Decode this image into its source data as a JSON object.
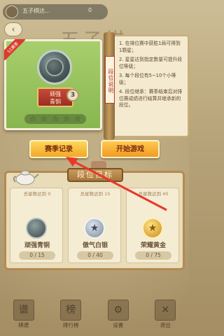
{
  "top_bar": {
    "name": "五子棋达...",
    "count": "0"
  },
  "background": {
    "title": "五子棋"
  },
  "rank_card": {
    "season_tag": "S1赛季",
    "rank_name_line1": "顽强",
    "rank_name_line2": "青铜",
    "tier": "3",
    "stars": [
      "☆",
      "☆",
      "☆",
      "☆",
      "☆"
    ]
  },
  "help": {
    "tag": "段位说明",
    "rules": [
      "1. 在排位赛中获胜1局可得到1颗星；",
      "2. 星星达到指定数量可提升段位等级；",
      "3. 每个段位有5~10个小等级；",
      "4. 段位继承：赛季结束后对排位赛成绩进行结算并继承新的段位。"
    ]
  },
  "buttons": {
    "records": "赛季记录",
    "start": "开始游戏"
  },
  "goals": {
    "title": "段位目标",
    "items": [
      {
        "requirement": "总星数达到 0",
        "name": "顽强青铜",
        "progress": "0 / 15"
      },
      {
        "requirement": "总星数达到 15",
        "name": "傲气白银",
        "progress": "0 / 40"
      },
      {
        "requirement": "总星数达到 40",
        "name": "荣耀黄金",
        "progress": "0 / 75"
      }
    ]
  },
  "nav": [
    {
      "label": "棋谱",
      "glyph": "谱"
    },
    {
      "label": "排行榜",
      "glyph": "榜"
    },
    {
      "label": "设置",
      "glyph": "⚙"
    },
    {
      "label": "退出",
      "glyph": "✕"
    }
  ],
  "colors": {
    "arrow": "#e8382a",
    "accent": "#f1a926"
  }
}
